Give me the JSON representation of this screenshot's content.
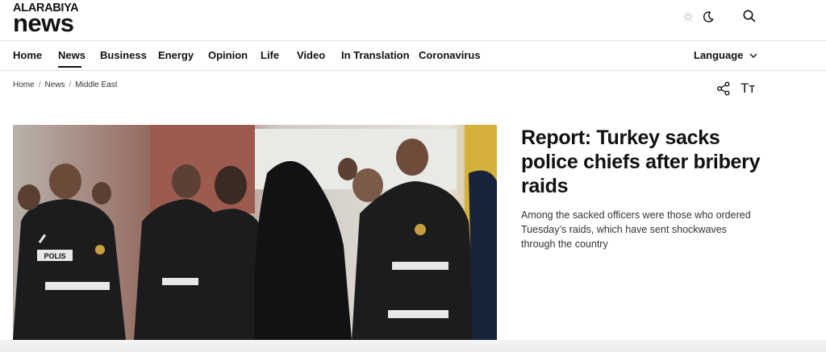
{
  "brand": {
    "logo_top": "ALARABIYA",
    "logo_main": "news"
  },
  "header": {
    "theme_icons": [
      "sun-icon",
      "moon-icon"
    ],
    "search_icon": "search-icon"
  },
  "nav": {
    "items": [
      {
        "label": "Home"
      },
      {
        "label": "News",
        "active": true
      },
      {
        "label": "Business"
      },
      {
        "label": "Energy"
      },
      {
        "label": "Opinion"
      },
      {
        "label": "Life"
      },
      {
        "label": "Video"
      },
      {
        "label": "In Translation"
      },
      {
        "label": "Coronavirus"
      }
    ],
    "language_label": "Language"
  },
  "breadcrumb": [
    "Home",
    "News",
    "Middle East"
  ],
  "article_tools": {
    "share_icon": "share-icon",
    "font_size_label": "Tт"
  },
  "article": {
    "headline": "Report: Turkey sacks police chiefs after bribery raids",
    "summary": "Among the sacked officers were those who ordered Tuesday’s raids, which have sent shockwaves through the country",
    "image_badge": "POLIS"
  },
  "colors": {
    "text": "#111111",
    "divider": "#e6e6e6",
    "accent": "#111111"
  }
}
